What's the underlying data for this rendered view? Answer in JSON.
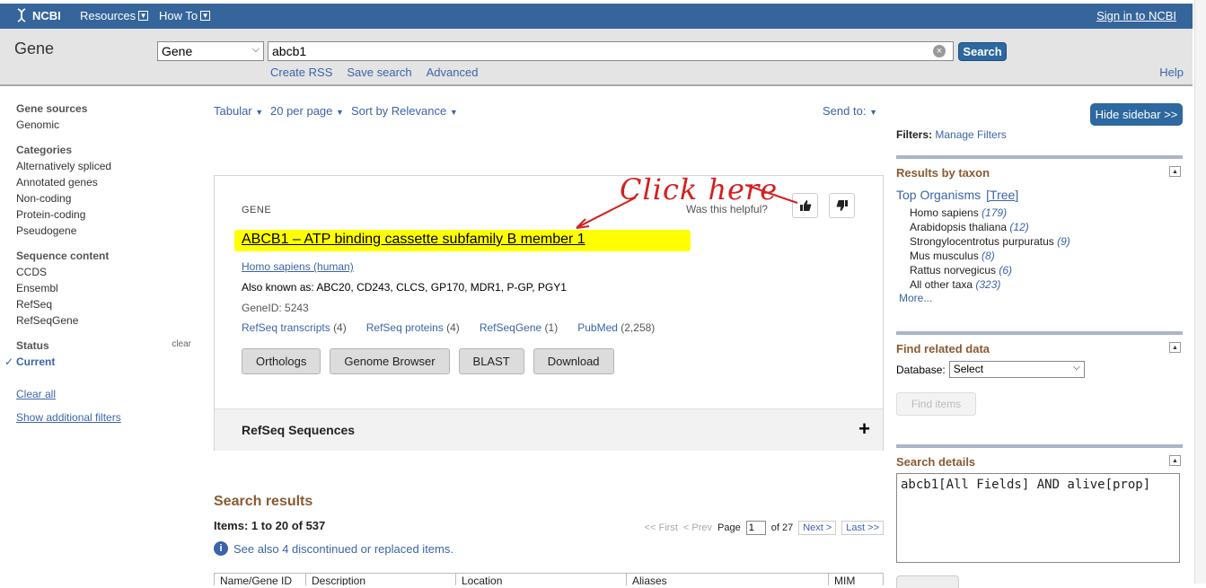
{
  "header": {
    "logo_text": "NCBI",
    "resources_label": "Resources",
    "howto_label": "How To",
    "signin_label": "Sign in to NCBI"
  },
  "search": {
    "db_title": "Gene",
    "db_select_value": "Gene",
    "term_value": "abcb1",
    "search_button": "Search",
    "links": [
      "Create RSS",
      "Save search",
      "Advanced"
    ],
    "help_label": "Help"
  },
  "left_sidebar": {
    "gene_sources": {
      "title": "Gene sources",
      "items": [
        "Genomic"
      ]
    },
    "categories": {
      "title": "Categories",
      "items": [
        "Alternatively spliced",
        "Annotated genes",
        "Non-coding",
        "Protein-coding",
        "Pseudogene"
      ]
    },
    "sequence_content": {
      "title": "Sequence content",
      "items": [
        "CCDS",
        "Ensembl",
        "RefSeq",
        "RefSeqGene"
      ]
    },
    "status": {
      "title": "Status",
      "clear_label": "clear",
      "current": "Current"
    },
    "clear_all": "Clear all",
    "show_filters": "Show additional filters"
  },
  "toolbar": {
    "format": "Tabular",
    "per_page": "20 per page",
    "sort": "Sort by Relevance",
    "send_to": "Send to:"
  },
  "gene_card": {
    "label": "GENE",
    "helpful": "Was this helpful?",
    "title": "ABCB1 – ATP binding cassette subfamily B member 1",
    "organism": "Homo sapiens (human)",
    "aka": "Also known as: ABC20, CD243, CLCS, GP170, MDR1, P-GP, PGY1",
    "gene_id": "GeneID: 5243",
    "resource_links": [
      {
        "label": "RefSeq transcripts",
        "count": "(4)"
      },
      {
        "label": "RefSeq proteins",
        "count": "(4)"
      },
      {
        "label": "RefSeqGene",
        "count": "(1)"
      },
      {
        "label": "PubMed",
        "count": "(2,258)"
      }
    ],
    "buttons": [
      "Orthologs",
      "Genome Browser",
      "BLAST",
      "Download"
    ],
    "refseq_section": "RefSeq Sequences"
  },
  "annotation": {
    "text": "Click here",
    "color": "#d42020"
  },
  "results": {
    "heading": "Search results",
    "items": "Items: 1 to 20 of 537",
    "see_also": "See also 4 discontinued or replaced items.",
    "pager": {
      "first": "<< First",
      "prev": "< Prev",
      "page_label": "Page",
      "page_value": "1",
      "of": "of 27",
      "next": "Next >",
      "last": "Last >>"
    },
    "columns": [
      "Name/Gene ID",
      "Description",
      "Location",
      "Aliases",
      "MIM"
    ]
  },
  "right_sidebar": {
    "hide_button": "Hide sidebar >>",
    "filters_label": "Filters:",
    "manage_filters": "Manage Filters",
    "taxon": {
      "title": "Results by taxon",
      "top_organisms": "Top Organisms",
      "tree": "[Tree]",
      "organisms": [
        {
          "name": "Homo sapiens",
          "count": "(179)"
        },
        {
          "name": "Arabidopsis thaliana",
          "count": "(12)"
        },
        {
          "name": "Strongylocentrotus purpuratus",
          "count": "(9)"
        },
        {
          "name": "Mus musculus",
          "count": "(8)"
        },
        {
          "name": "Rattus norvegicus",
          "count": "(6)"
        },
        {
          "name": "All other taxa",
          "count": "(323)"
        }
      ],
      "more": "More..."
    },
    "related": {
      "title": "Find related data",
      "db_label": "Database:",
      "db_value": "Select",
      "find_button": "Find items"
    },
    "details": {
      "title": "Search details",
      "query": "abcb1[All Fields] AND alive[prop]"
    }
  },
  "colors": {
    "header_bar": "#35659b",
    "highlight": "#ffff00",
    "accent_link": "#3b64a8",
    "section_heading": "#8a5a32"
  }
}
